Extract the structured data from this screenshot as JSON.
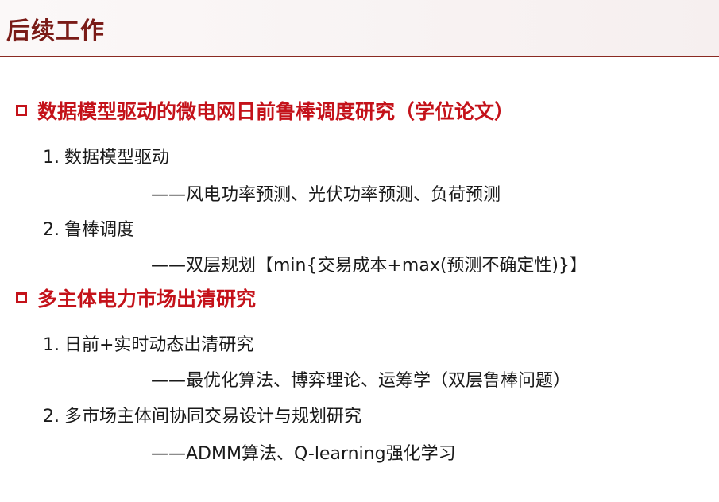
{
  "header": {
    "title": "后续工作"
  },
  "sections": [
    {
      "title": "数据模型驱动的微电网日前鲁棒调度研究（学位论文）",
      "items": [
        {
          "number": "1.",
          "label": "数据模型驱动",
          "detail": "——风电功率预测、光伏功率预测、负荷预测"
        },
        {
          "number": "2.",
          "label": "鲁棒调度",
          "detail": "——双层规划【min{交易成本+max(预测不确定性)}】"
        }
      ]
    },
    {
      "title": "多主体电力市场出清研究",
      "items": [
        {
          "number": "1.",
          "label": "日前+实时动态出清研究",
          "detail": "——最优化算法、博弈理论、运筹学（双层鲁棒问题）"
        },
        {
          "number": "2.",
          "label": "多市场主体间协同交易设计与规划研究",
          "detail": "——ADMM算法、Q-learning强化学习"
        }
      ]
    }
  ],
  "colors": {
    "title": "#7a1b17",
    "accent": "#c4121a",
    "rule": "#8a2a22",
    "text": "#1a1a1a"
  }
}
